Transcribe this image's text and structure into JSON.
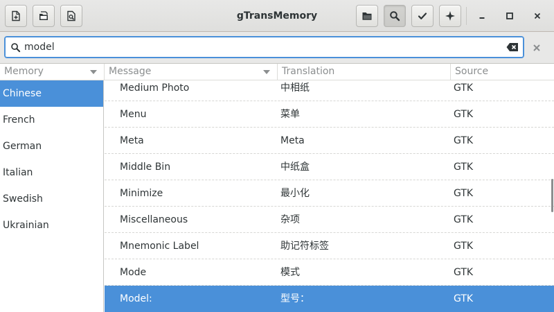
{
  "window": {
    "title": "gTransMemory"
  },
  "header": {
    "left_buttons": [
      {
        "name": "new-document-icon"
      },
      {
        "name": "open-document-icon"
      },
      {
        "name": "print-preview-icon"
      }
    ],
    "right_buttons": [
      {
        "name": "folder-icon"
      },
      {
        "name": "search-icon"
      },
      {
        "name": "checkmark-icon"
      },
      {
        "name": "sparkle-icon"
      }
    ],
    "window_controls": [
      "minimize-icon",
      "maximize-icon",
      "close-icon"
    ]
  },
  "search": {
    "value": "model",
    "placeholder": ""
  },
  "columns": {
    "memory": "Memory",
    "message": "Message",
    "translation": "Translation",
    "source": "Source"
  },
  "memories": [
    {
      "label": "Chinese",
      "selected": true
    },
    {
      "label": "French"
    },
    {
      "label": "German"
    },
    {
      "label": "Italian"
    },
    {
      "label": "Swedish"
    },
    {
      "label": "Ukrainian"
    }
  ],
  "rows": [
    {
      "message": "Medium Photo",
      "translation": "中相纸",
      "source": "GTK"
    },
    {
      "message": "Menu",
      "translation": "菜单",
      "source": "GTK"
    },
    {
      "message": "Meta",
      "translation": "Meta",
      "source": "GTK"
    },
    {
      "message": "Middle Bin",
      "translation": "中纸盒",
      "source": "GTK"
    },
    {
      "message": "Minimize",
      "translation": "最小化",
      "source": "GTK"
    },
    {
      "message": "Miscellaneous",
      "translation": "杂项",
      "source": "GTK"
    },
    {
      "message": "Mnemonic Label",
      "translation": "助记符标签",
      "source": "GTK"
    },
    {
      "message": "Mode",
      "translation": "模式",
      "source": "GTK"
    },
    {
      "message": "Model:",
      "translation": "型号：",
      "source": "GTK",
      "selected": true
    }
  ],
  "colors": {
    "accent": "#4a90d9",
    "headerbar": "#e8e8e7",
    "text": "#2e3436",
    "column_header_text": "#8b8e8f"
  }
}
